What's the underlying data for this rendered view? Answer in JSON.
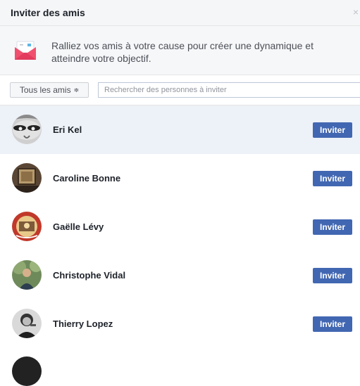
{
  "dialog": {
    "title": "Inviter des amis",
    "close_glyph": "×"
  },
  "intro": {
    "icon": "envelope-icon",
    "text": "Ralliez vos amis à votre cause pour créer une dynamique et atteindre votre objectif."
  },
  "filter": {
    "selected": "Tous les amis",
    "arrow": "≑"
  },
  "search": {
    "placeholder": "Rechercher des personnes à inviter",
    "value": ""
  },
  "friends": [
    {
      "name": "Eri Kel",
      "button": "Inviter",
      "highlighted": true
    },
    {
      "name": "Caroline Bonne",
      "button": "Inviter",
      "highlighted": false
    },
    {
      "name": "Gaëlle Lévy",
      "button": "Inviter",
      "highlighted": false
    },
    {
      "name": "Christophe Vidal",
      "button": "Inviter",
      "highlighted": false
    },
    {
      "name": "Thierry Lopez",
      "button": "Inviter",
      "highlighted": false
    }
  ],
  "colors": {
    "accent": "#4267b2",
    "highlight_row": "#edf1f8",
    "envelope": "#f0506e"
  }
}
